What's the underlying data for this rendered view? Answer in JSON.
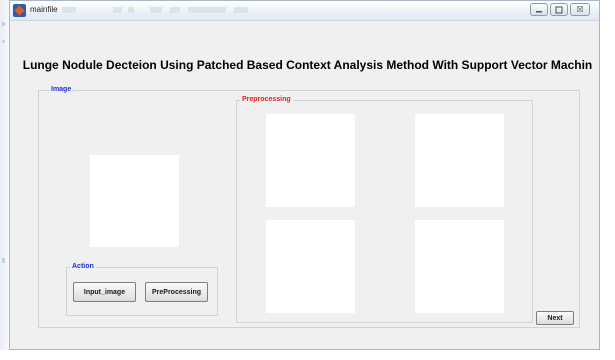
{
  "window": {
    "title": "mainfile",
    "controls": {
      "minimize_icon": "minimize-icon",
      "maximize_icon": "maximize-icon",
      "close_icon": "close-icon",
      "close_glyph": "☒"
    }
  },
  "app": {
    "heading": "Lunge Nodule Decteion Using Patched Based Context Analysis Method With Support Vector Machin"
  },
  "panels": {
    "image": {
      "legend": "Image",
      "legend_color": "#1f2fd1"
    },
    "preprocessing": {
      "legend": "Preprocessing",
      "legend_color": "#e0211a"
    },
    "action": {
      "legend": "Action",
      "legend_color": "#1f2fd1"
    }
  },
  "buttons": {
    "input_image": "Input_image",
    "preprocessing": "PreProcessing",
    "next": "Next"
  }
}
